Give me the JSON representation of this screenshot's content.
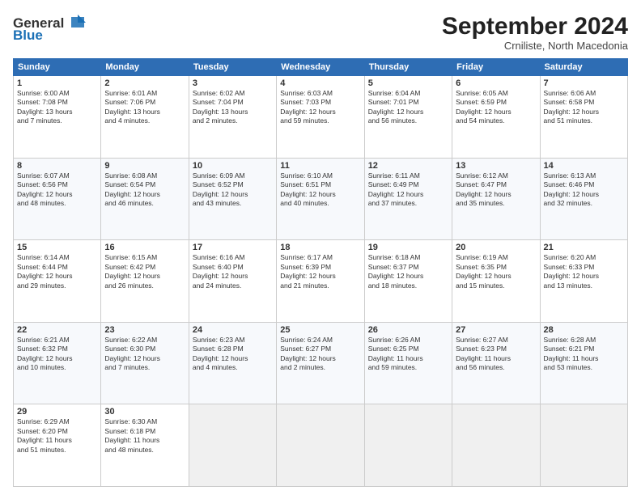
{
  "header": {
    "logo_line1": "General",
    "logo_line2": "Blue",
    "month": "September 2024",
    "location": "Crniliste, North Macedonia"
  },
  "days_of_week": [
    "Sunday",
    "Monday",
    "Tuesday",
    "Wednesday",
    "Thursday",
    "Friday",
    "Saturday"
  ],
  "weeks": [
    [
      {
        "day": "1",
        "info": "Sunrise: 6:00 AM\nSunset: 7:08 PM\nDaylight: 13 hours\nand 7 minutes."
      },
      {
        "day": "2",
        "info": "Sunrise: 6:01 AM\nSunset: 7:06 PM\nDaylight: 13 hours\nand 4 minutes."
      },
      {
        "day": "3",
        "info": "Sunrise: 6:02 AM\nSunset: 7:04 PM\nDaylight: 13 hours\nand 2 minutes."
      },
      {
        "day": "4",
        "info": "Sunrise: 6:03 AM\nSunset: 7:03 PM\nDaylight: 12 hours\nand 59 minutes."
      },
      {
        "day": "5",
        "info": "Sunrise: 6:04 AM\nSunset: 7:01 PM\nDaylight: 12 hours\nand 56 minutes."
      },
      {
        "day": "6",
        "info": "Sunrise: 6:05 AM\nSunset: 6:59 PM\nDaylight: 12 hours\nand 54 minutes."
      },
      {
        "day": "7",
        "info": "Sunrise: 6:06 AM\nSunset: 6:58 PM\nDaylight: 12 hours\nand 51 minutes."
      }
    ],
    [
      {
        "day": "8",
        "info": "Sunrise: 6:07 AM\nSunset: 6:56 PM\nDaylight: 12 hours\nand 48 minutes."
      },
      {
        "day": "9",
        "info": "Sunrise: 6:08 AM\nSunset: 6:54 PM\nDaylight: 12 hours\nand 46 minutes."
      },
      {
        "day": "10",
        "info": "Sunrise: 6:09 AM\nSunset: 6:52 PM\nDaylight: 12 hours\nand 43 minutes."
      },
      {
        "day": "11",
        "info": "Sunrise: 6:10 AM\nSunset: 6:51 PM\nDaylight: 12 hours\nand 40 minutes."
      },
      {
        "day": "12",
        "info": "Sunrise: 6:11 AM\nSunset: 6:49 PM\nDaylight: 12 hours\nand 37 minutes."
      },
      {
        "day": "13",
        "info": "Sunrise: 6:12 AM\nSunset: 6:47 PM\nDaylight: 12 hours\nand 35 minutes."
      },
      {
        "day": "14",
        "info": "Sunrise: 6:13 AM\nSunset: 6:46 PM\nDaylight: 12 hours\nand 32 minutes."
      }
    ],
    [
      {
        "day": "15",
        "info": "Sunrise: 6:14 AM\nSunset: 6:44 PM\nDaylight: 12 hours\nand 29 minutes."
      },
      {
        "day": "16",
        "info": "Sunrise: 6:15 AM\nSunset: 6:42 PM\nDaylight: 12 hours\nand 26 minutes."
      },
      {
        "day": "17",
        "info": "Sunrise: 6:16 AM\nSunset: 6:40 PM\nDaylight: 12 hours\nand 24 minutes."
      },
      {
        "day": "18",
        "info": "Sunrise: 6:17 AM\nSunset: 6:39 PM\nDaylight: 12 hours\nand 21 minutes."
      },
      {
        "day": "19",
        "info": "Sunrise: 6:18 AM\nSunset: 6:37 PM\nDaylight: 12 hours\nand 18 minutes."
      },
      {
        "day": "20",
        "info": "Sunrise: 6:19 AM\nSunset: 6:35 PM\nDaylight: 12 hours\nand 15 minutes."
      },
      {
        "day": "21",
        "info": "Sunrise: 6:20 AM\nSunset: 6:33 PM\nDaylight: 12 hours\nand 13 minutes."
      }
    ],
    [
      {
        "day": "22",
        "info": "Sunrise: 6:21 AM\nSunset: 6:32 PM\nDaylight: 12 hours\nand 10 minutes."
      },
      {
        "day": "23",
        "info": "Sunrise: 6:22 AM\nSunset: 6:30 PM\nDaylight: 12 hours\nand 7 minutes."
      },
      {
        "day": "24",
        "info": "Sunrise: 6:23 AM\nSunset: 6:28 PM\nDaylight: 12 hours\nand 4 minutes."
      },
      {
        "day": "25",
        "info": "Sunrise: 6:24 AM\nSunset: 6:27 PM\nDaylight: 12 hours\nand 2 minutes."
      },
      {
        "day": "26",
        "info": "Sunrise: 6:26 AM\nSunset: 6:25 PM\nDaylight: 11 hours\nand 59 minutes."
      },
      {
        "day": "27",
        "info": "Sunrise: 6:27 AM\nSunset: 6:23 PM\nDaylight: 11 hours\nand 56 minutes."
      },
      {
        "day": "28",
        "info": "Sunrise: 6:28 AM\nSunset: 6:21 PM\nDaylight: 11 hours\nand 53 minutes."
      }
    ],
    [
      {
        "day": "29",
        "info": "Sunrise: 6:29 AM\nSunset: 6:20 PM\nDaylight: 11 hours\nand 51 minutes."
      },
      {
        "day": "30",
        "info": "Sunrise: 6:30 AM\nSunset: 6:18 PM\nDaylight: 11 hours\nand 48 minutes."
      },
      {
        "day": "",
        "info": ""
      },
      {
        "day": "",
        "info": ""
      },
      {
        "day": "",
        "info": ""
      },
      {
        "day": "",
        "info": ""
      },
      {
        "day": "",
        "info": ""
      }
    ]
  ]
}
